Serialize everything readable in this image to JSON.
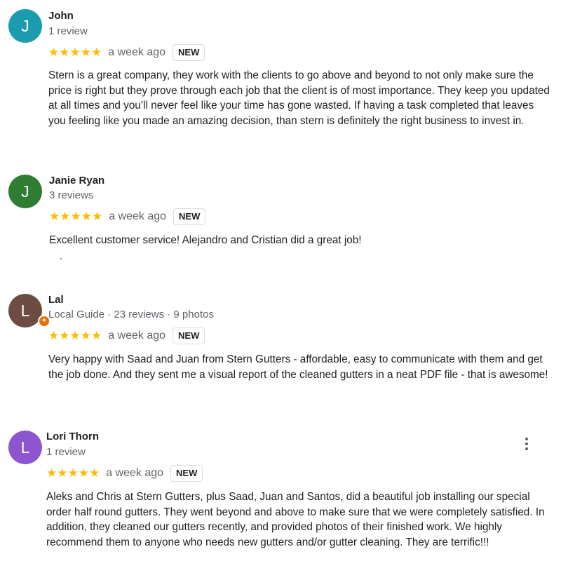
{
  "reviews": [
    {
      "avatar_letter": "J",
      "avatar_color": "#1a9bae",
      "name": "John",
      "meta": "1 review",
      "stars": "★★★★★",
      "rating": 5,
      "date": "a week ago",
      "badge": "NEW",
      "text": "Stern is a great company, they work with the clients to go above and beyond to not only make sure the price is right but they prove through each job that the client is of most importance. They keep you updated at all times and you’ll never feel like your time has gone wasted. If having a task completed that leaves you feeling like you made an amazing decision, than stern is definitely the right business to invest in."
    },
    {
      "avatar_letter": "J",
      "avatar_color": "#2e7d32",
      "name": "Janie Ryan",
      "meta": "3 reviews",
      "stars": "★★★★★",
      "rating": 5,
      "date": "a week ago",
      "badge": "NEW",
      "text": "Excellent customer service! Alejandro and Cristian did a great job!"
    },
    {
      "avatar_letter": "L",
      "avatar_color": "#6d4c41",
      "local_guide_badge_color": "#e8710a",
      "local_guide_icon": "local-guide-star",
      "name": "Lal",
      "meta": "Local Guide · 23 reviews · 9 photos",
      "stars": "★★★★★",
      "rating": 5,
      "date": "a week ago",
      "badge": "NEW",
      "text": "Very happy with Saad and Juan from Stern Gutters - affordable, easy to communicate with them and get the job done. And they sent me a visual report of the cleaned gutters in a neat PDF file - that is awesome!"
    },
    {
      "avatar_letter": "L",
      "avatar_color": "#8e55d0",
      "name": "Lori Thorn",
      "meta": "1 review",
      "stars": "★★★★★",
      "rating": 5,
      "date": "a week ago",
      "badge": "NEW",
      "more_icon": "more-vert",
      "text": "Aleks and Chris at Stern Gutters, plus Saad, Juan and Santos, did a beautiful job installing our special order half round gutters. They went beyond and above to make sure that we were completely satisfied. In addition, they cleaned our gutters recently, and provided photos of their finished work. We highly recommend them to anyone who needs new gutters and/or gutter cleaning. They are terrific!!!"
    }
  ]
}
